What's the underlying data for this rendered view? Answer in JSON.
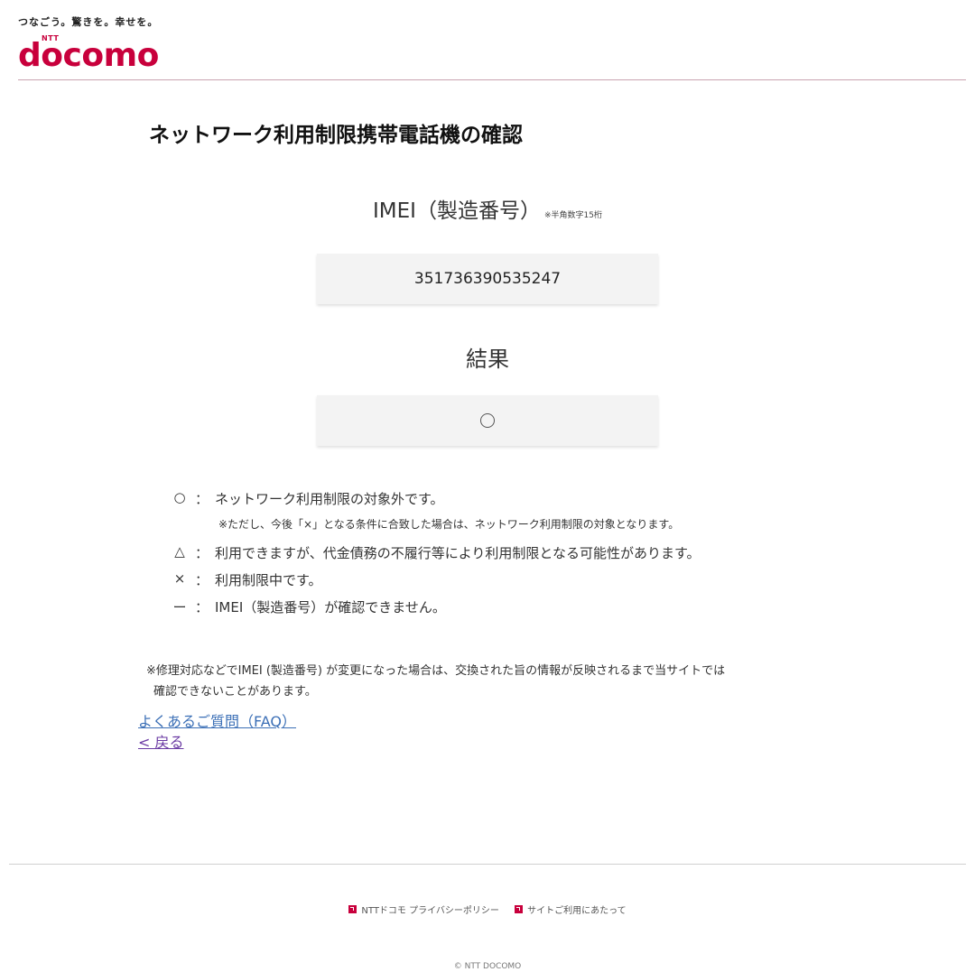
{
  "header": {
    "tagline": "つなごう。驚きを。幸せを。",
    "logo_small": "NTT",
    "logo_word": "docomo"
  },
  "page_title": "ネットワーク利用制限携帯電話機の確認",
  "imei": {
    "label": "IMEI（製造番号）",
    "note": "※半角数字15桁",
    "value": "351736390535247"
  },
  "result": {
    "label": "結果",
    "value_icon": "circle-mark-icon"
  },
  "legend": {
    "items": [
      {
        "symbol": "○",
        "colon": "：",
        "text": "ネットワーク利用制限の対象外です。",
        "sub": "※ただし、今後「×」となる条件に合致した場合は、ネットワーク利用制限の対象となります。"
      },
      {
        "symbol": "△",
        "colon": "：",
        "text": "利用できますが、代金債務の不履行等により利用制限となる可能性があります。"
      },
      {
        "symbol": "×",
        "colon": "：",
        "text": "利用制限中です。"
      },
      {
        "symbol": "ー",
        "colon": "：",
        "text": "IMEI（製造番号）が確認できません。"
      }
    ]
  },
  "footnote": {
    "line1": "※修理対応などでIMEI (製造番号) が変更になった場合は、交換された旨の情報が反映されるまで当サイトでは",
    "line2": "確認できないことがあります。"
  },
  "links": {
    "faq": "よくあるご質問（FAQ）",
    "back": "< 戻る"
  },
  "footer": {
    "privacy": "NTTドコモ プライバシーポリシー",
    "terms": "サイトご利用にあたって",
    "copyright": "© NTT DOCOMO"
  },
  "colors": {
    "brand": "#c8003c",
    "link": "#3b6fb6",
    "visited_link": "#6a3aa3"
  }
}
